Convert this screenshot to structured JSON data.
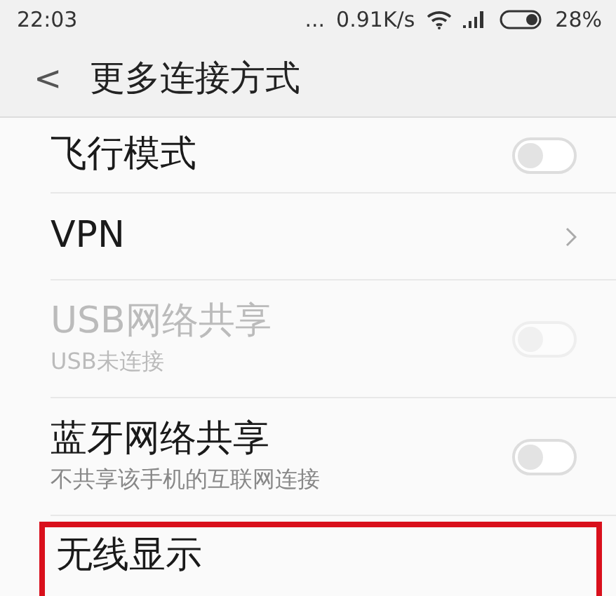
{
  "status_bar": {
    "time": "22:03",
    "dots": "...",
    "speed": "0.91K/s",
    "battery": "28%"
  },
  "header": {
    "back": "<",
    "title": "更多连接方式"
  },
  "items": [
    {
      "kind": "toggle",
      "title": "飞行模式",
      "on": false,
      "disabled": false,
      "highlighted": false
    },
    {
      "kind": "link",
      "title": "VPN",
      "disabled": false,
      "highlighted": false
    },
    {
      "kind": "toggle",
      "title": "USB网络共享",
      "subtitle": "USB未连接",
      "on": false,
      "disabled": true,
      "highlighted": false
    },
    {
      "kind": "toggle",
      "title": "蓝牙网络共享",
      "subtitle": "不共享该手机的互联网连接",
      "on": false,
      "disabled": false,
      "highlighted": false
    },
    {
      "title": "无线显示",
      "disabled": false,
      "highlighted": true
    }
  ]
}
